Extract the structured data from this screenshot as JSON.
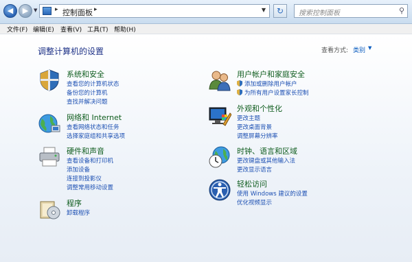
{
  "address": {
    "path": "控制面板"
  },
  "search": {
    "placeholder": "搜索控制面板"
  },
  "menu": [
    "文件(F)",
    "编辑(E)",
    "查看(V)",
    "工具(T)",
    "帮助(H)"
  ],
  "page": {
    "title": "调整计算机的设置",
    "view_by_label": "查看方式:",
    "view_by_value": "类别"
  },
  "categories": [
    {
      "title": "系统和安全",
      "links": [
        "查看您的计算机状态",
        "备份您的计算机",
        "查找并解决问题"
      ]
    },
    {
      "title": "网络和 Internet",
      "links": [
        "查看网络状态和任务",
        "选择家庭组和共享选项"
      ]
    },
    {
      "title": "硬件和声音",
      "links": [
        "查看设备和打印机",
        "添加设备",
        "连接到投影仪",
        "调整常用移动设置"
      ]
    },
    {
      "title": "程序",
      "links": [
        "卸载程序"
      ]
    },
    {
      "title": "用户帐户和家庭安全",
      "links": [
        "添加或删除用户帐户",
        "为所有用户设置家长控制"
      ]
    },
    {
      "title": "外观和个性化",
      "links": [
        "更改主题",
        "更改桌面背景",
        "调整屏幕分辨率"
      ]
    },
    {
      "title": "时钟、语言和区域",
      "links": [
        "更改键盘或其他输入法",
        "更改显示语言"
      ]
    },
    {
      "title": "轻松访问",
      "links": [
        "使用 Windows 建议的设置",
        "优化视频显示"
      ]
    }
  ]
}
